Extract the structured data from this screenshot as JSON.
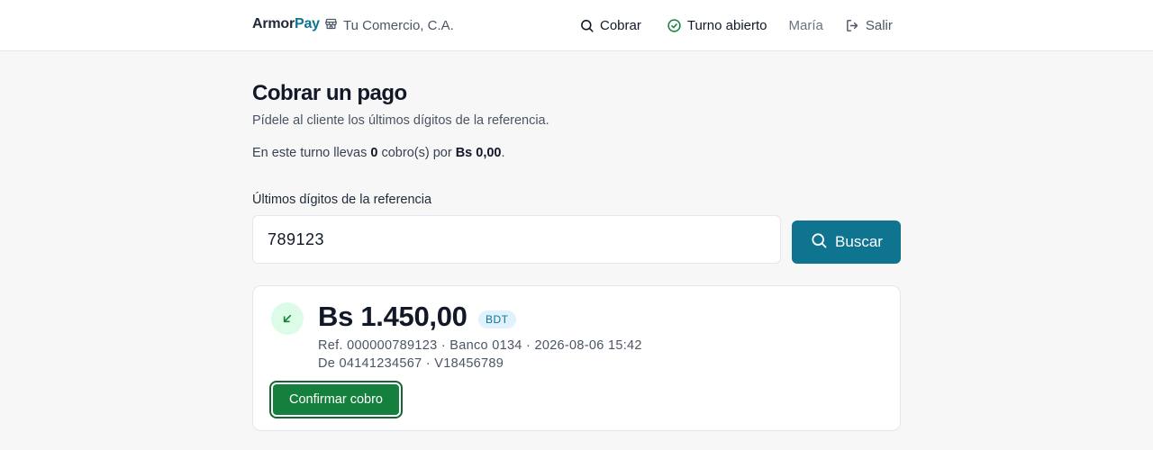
{
  "header": {
    "brand_part1": "Armor",
    "brand_part2": "Pay",
    "store_name": "Tu Comercio, C.A.",
    "nav": {
      "charge_label": "Cobrar",
      "shift_label": "Turno abierto",
      "user_name": "María",
      "logout_label": "Salir"
    }
  },
  "main": {
    "title": "Cobrar un pago",
    "subtitle": "Pídele al cliente los últimos dígitos de la referencia.",
    "summary": {
      "prefix": "En este turno llevas ",
      "count": "0",
      "middle": " cobro(s) por ",
      "total": "Bs 0,00",
      "suffix": "."
    },
    "search": {
      "label": "Últimos dígitos de la referencia",
      "value": "789123",
      "button_label": "Buscar"
    },
    "result": {
      "amount": "Bs 1.450,00",
      "currency_badge": "BDT",
      "detail_line1": "Ref. 000000789123 · Banco 0134 · 2026-08-06 15:42",
      "detail_line2": "De 04141234567 · V18456789",
      "confirm_label": "Confirmar cobro"
    }
  },
  "colors": {
    "accent": "#0e7490",
    "success": "#15803d",
    "success_light": "#dcfce7"
  },
  "icons": {
    "store": "store-icon",
    "search": "search-icon",
    "shift": "check-circle-icon",
    "logout": "logout-icon",
    "incoming": "arrow-down-left-icon"
  }
}
